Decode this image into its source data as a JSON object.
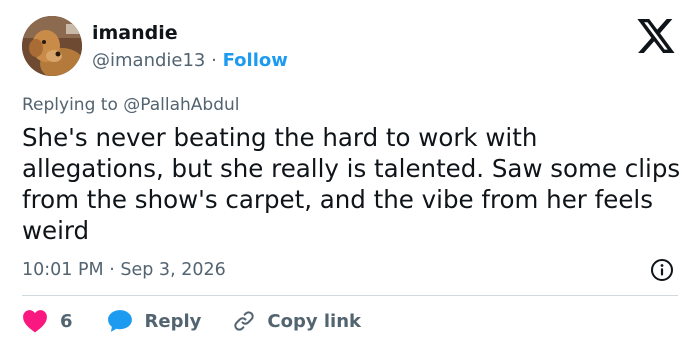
{
  "author": {
    "name": "imandie",
    "handle": "@imandie13",
    "separator": "·",
    "follow_label": "Follow"
  },
  "reply": {
    "prefix": "Replying to",
    "mention": "@PallahAbdul"
  },
  "tweet": {
    "text": "She's never beating the hard to work with allegations,  but she really is talented. Saw some clips from the show's carpet, and the vibe from her feels weird"
  },
  "meta": {
    "time": "10:01 PM",
    "separator": "·",
    "date": "Sep 3, 2026"
  },
  "actions": {
    "like_count": "6",
    "reply_label": "Reply",
    "copy_label": "Copy link"
  },
  "icons": {
    "logo": "x-logo-icon",
    "info": "info-icon",
    "like": "heart-icon",
    "reply": "speech-bubble-icon",
    "copy": "link-icon"
  },
  "colors": {
    "accent": "#1d9bf0",
    "like": "#f91880",
    "secondary_text": "#536471",
    "text": "#0f1419"
  }
}
